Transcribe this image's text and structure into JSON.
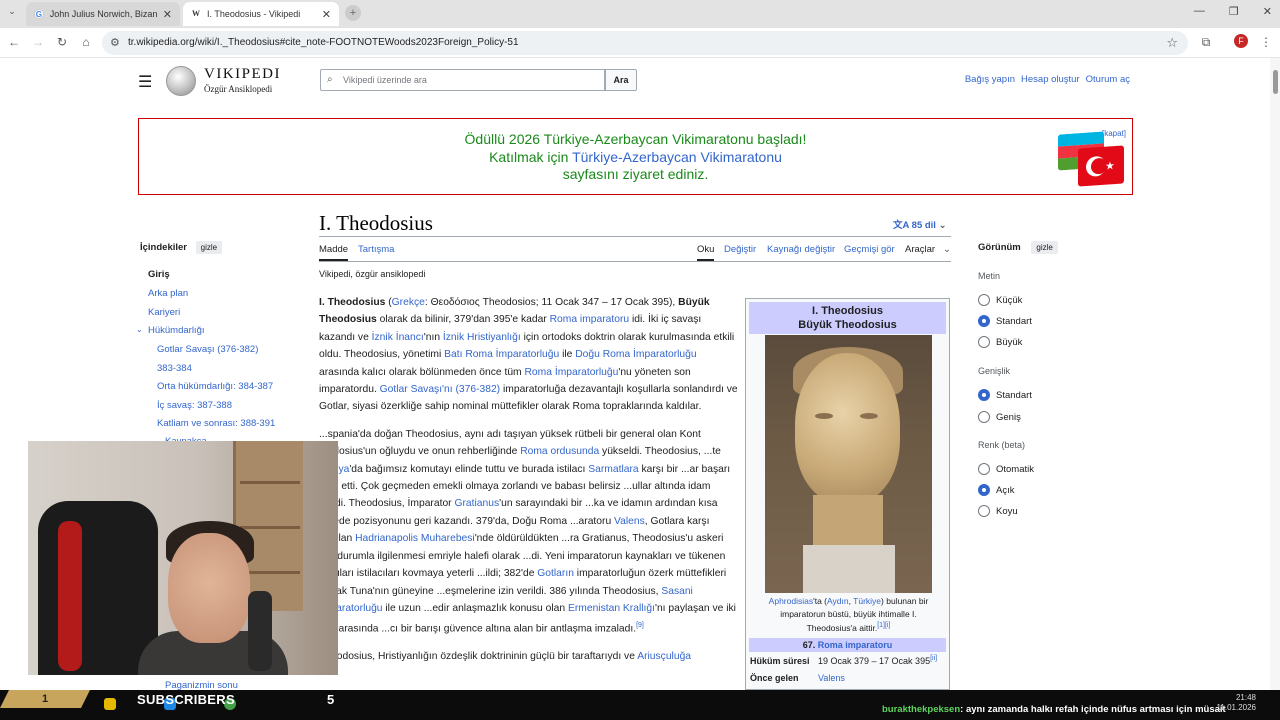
{
  "browser": {
    "tabs": [
      {
        "title": "John Julius Norwich, Bizans I Eri",
        "active": false
      },
      {
        "title": "I. Theodosius - Vikipedi",
        "active": true
      }
    ],
    "url": "tr.wikipedia.org/wiki/I._Theodosius#cite_note-FOOTNOTEWoods2023Foreign_Policy-51"
  },
  "wiki": {
    "logo_title": "Vikipedi",
    "logo_tagline": "Özgür Ansiklopedi",
    "search_placeholder": "Vikipedi üzerinde ara",
    "search_button": "Ara",
    "user_links": [
      "Bağış yapın",
      "Hesap oluştur",
      "Oturum aç"
    ]
  },
  "banner": {
    "line1": "Ödüllü 2026 Türkiye-Azerbaycan Vikimaratonu başladı!",
    "line2_pre": "Katılmak için ",
    "line2_link": "Türkiye-Azerbaycan Vikimaratonu",
    "line3": "sayfasını ziyaret ediniz.",
    "close": "[kapat]"
  },
  "toc": {
    "heading": "İçindekiler",
    "hide": "gizle",
    "items": [
      "Giriş",
      "Arka plan",
      "Kariyeri",
      "Hükümdarlığı",
      "Gotlar Savaşı (376-382)",
      "383-384",
      "Orta hükümdarlığı: 384-387",
      "İç savaş: 387-388",
      "Katliam ve sonrası: 388-391",
      "Kaynakça",
      "Paganizmin sonu"
    ]
  },
  "article": {
    "title": "I. Theodosius",
    "languages": "85 dil",
    "tabs_left": [
      "Madde",
      "Tartışma"
    ],
    "tabs_right": [
      "Oku",
      "Değiştir",
      "Kaynağı değiştir",
      "Geçmişi gör",
      "Araçlar"
    ],
    "from": "Vikipedi, özgür ansiklopedi",
    "p1": {
      "a": "I. Theodosius",
      "b": " (",
      "c": "Grekçe",
      "d": ": Θεοδόσιος Theodosios; 11 Ocak 347 – 17 Ocak 395), ",
      "e": "Büyük Theodosius",
      "f": " olarak da bilinir, 379'dan 395'e kadar ",
      "g": "Roma imparatoru",
      "h": " idi. İki iç savaşı kazandı ve ",
      "i": "İznik İnancı",
      "j": "'nın ",
      "k": "İznik Hristiyanlığı",
      "l": " için ortodoks doktrin olarak kurulmasında etkili oldu. Theodosius, yönetimi ",
      "m": "Batı Roma İmparatorluğu",
      "n": " ile ",
      "o": "Doğu Roma İmparatorluğu",
      "p": " arasında kalıcı olarak bölünmeden önce tüm ",
      "q": "Roma İmparatorluğu",
      "r": "'nu yöneten son imparatordu. ",
      "s": "Gotlar Savaşı'nı (376-382)",
      "t": " imparatorluğa dezavantajlı koşullarla sonlandırdı ve Gotlar, siyasi özerkliğe sahip nominal müttefikler olarak Roma topraklarında kaldılar."
    },
    "p2": {
      "a": "...spania'da doğan Theodosius, aynı adı taşıyan yüksek rütbeli bir general olan Kont ...odosius'un oğluydu ve onun rehberliğinde ",
      "b": "Roma ordusunda",
      "c": " yükseldi. Theodosius, ...te ",
      "d": "Mezya",
      "e": "'da bağımsız komutayı elinde tuttu ve burada istilacı ",
      "f": "Sarmatlara",
      "g": " karşı bir ...ar başarı elde etti. Çok geçmeden emekli olmaya zorlandı ve babası belirsiz ...ullar altında idam edildi. Theodosius, İmparator ",
      "h": "Gratianus",
      "i": "'un sarayındaki bir ...ka ve idamın ardından kısa sürede pozisyonunu geri kazandı. 379'da, Doğu Roma ...aratoru ",
      "j": "Valens",
      "k": ", Gotlara karşı yapılan ",
      "l": "Hadrianapolis Muharebesi",
      "m": "'nde öldürüldükten ...ra Gratianus, Theodosius'u askeri acil durumla ilgilenmesi emriyle halefi olarak ...di. Yeni imparatorun kaynakları ve tükenen orduları istilacıları kovmaya yeterli ...ildi; 382'de ",
      "n": "Gotların",
      "o": " imparatorluğun özerk müttefikleri olarak Tuna'nın güneyine ...eşmelerine izin verildi. 386 yılında Theodosius, ",
      "p": "Sasani İmparatorluğu",
      "q": " ile uzun ...edir anlaşmazlık konusu olan ",
      "r": "Ermenistan Krallığı",
      "s": "'nı paylaşan ve iki güç arasında ...cı bir barışı güvence altına alan bir antlaşma imzaladı.",
      "t": "[9]"
    },
    "p3": {
      "a": "Theodosius, Hristiyanlığın özdeşlik doktrininin güçlü bir taraftarıydı ve ",
      "b": "Ariusçuluğa"
    }
  },
  "infobox": {
    "title1": "I. Theodosius",
    "title2": "Büyük Theodosius",
    "image_alt": "bust",
    "caption_link1": "Aphrodisias",
    "caption_a": "'ta (",
    "caption_link2": "Aydın",
    "caption_b": ", ",
    "caption_link3": "Türkiye",
    "caption_c": ") bulunan bir imparatorun büstü, büyük ihtimalle I. Theodosius'a aittir.",
    "caption_sup": "[1][i]",
    "rank_num": "67.",
    "rank_link": "Roma imparatoru",
    "reign_label": "Hüküm süresi",
    "reign_value": "19 Ocak 379 – 17 Ocak 395",
    "reign_sup": "[ii]",
    "prev_label": "Önce gelen",
    "prev_value": "Valens"
  },
  "appearance": {
    "heading": "Görünüm",
    "hide": "gizle",
    "text_label": "Metin",
    "text_opts": [
      "Küçük",
      "Standart",
      "Büyük"
    ],
    "width_label": "Genişlik",
    "width_opts": [
      "Standart",
      "Geniş"
    ],
    "color_label": "Renk (beta)",
    "color_opts": [
      "Otomatik",
      "Açık",
      "Koyu"
    ]
  },
  "stream": {
    "badge": "1",
    "subs_label": "SUBSCRIBERS",
    "subs_count": "5",
    "chat_user": "burakthekpeksen",
    "chat_msg": ": aynı zamanda halkı refah içinde nüfus artması için müsait",
    "time": "21:48",
    "date": "11.01.2026"
  }
}
